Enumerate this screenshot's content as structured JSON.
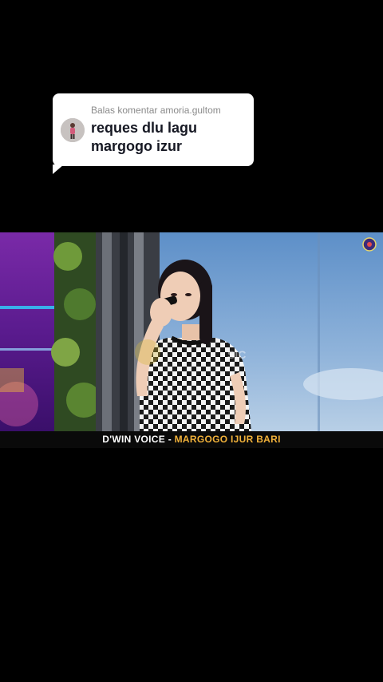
{
  "reply": {
    "header": "Balas komentar amoria.gultom",
    "text": "reques dlu lagu margogo izur"
  },
  "video": {
    "caption_artist": "D'WIN VOICE",
    "caption_separator": "-",
    "caption_song": "MARGOGO IJUR BARI",
    "caption_song_color": "#f2b23a"
  }
}
